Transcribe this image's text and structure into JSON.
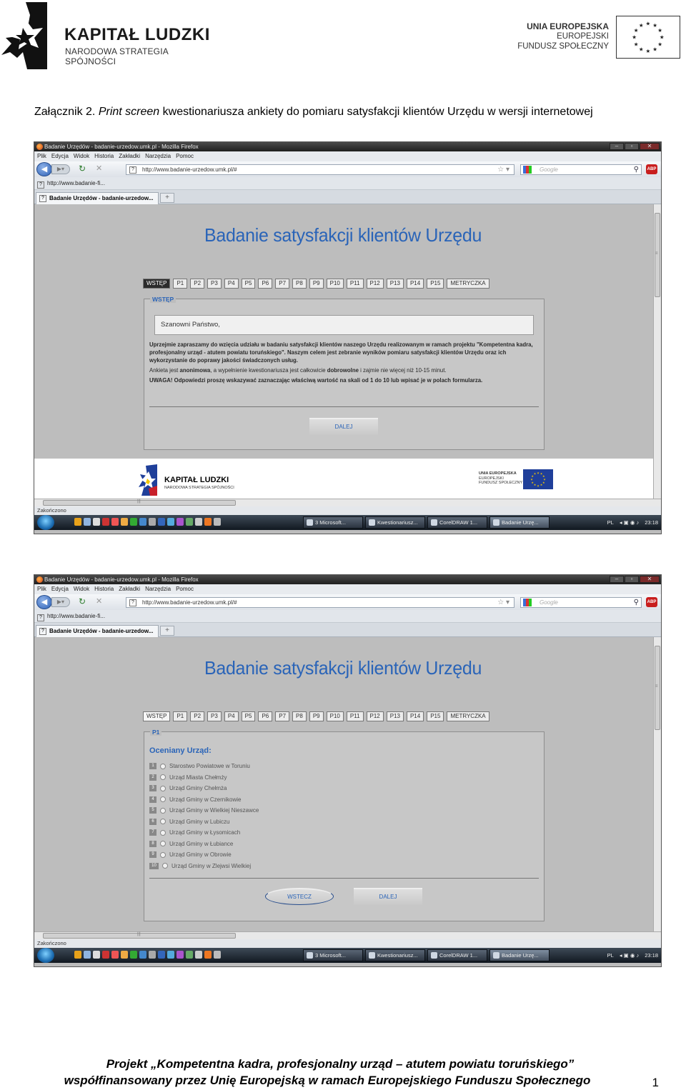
{
  "header": {
    "kl_title": "KAPITAŁ LUDZKI",
    "kl_subtitle": "NARODOWA STRATEGIA SPÓJNOŚCI",
    "ue_line1": "UNIA EUROPEJSKA",
    "ue_line2": "EUROPEJSKI",
    "ue_line3": "FUNDUSZ SPOŁECZNY"
  },
  "caption": {
    "prefix": "Załącznik 2. ",
    "italic": "Print screen",
    "rest": " kwestionariusza ankiety do pomiaru satysfakcji klientów Urzędu w wersji internetowej"
  },
  "browser": {
    "window_title": "Badanie Urzędów - badanie-urzedow.umk.pl - Mozilla Firefox",
    "menu": [
      "Plik",
      "Edycja",
      "Widok",
      "Historia",
      "Zakładki",
      "Narzędzia",
      "Pomoc"
    ],
    "url": "http://www.badanie-urzedow.umk.pl/#",
    "search_placeholder": "Google",
    "bookmark": "http://www.badanie-fi...",
    "tab": "Badanie Urzędów - badanie-urzedow...",
    "status": "Zakończono",
    "taskbar": {
      "tasks": [
        "3 Microsoft...",
        "Kwestionariusz...",
        "CorelDRAW 1...",
        "Badanie Urzę..."
      ],
      "lang": "PL",
      "time": "23:18"
    }
  },
  "survey": {
    "title": "Badanie satysfakcji klientów Urzędu",
    "steps": [
      "WSTĘP",
      "P1",
      "P2",
      "P3",
      "P4",
      "P5",
      "P6",
      "P7",
      "P8",
      "P9",
      "P10",
      "P11",
      "P12",
      "P13",
      "P14",
      "P15",
      "METRYCZKA"
    ],
    "footer_kl_title": "KAPITAŁ LUDZKI",
    "footer_kl_subtitle": "NARODOWA STRATEGIA SPÓJNOŚCI",
    "footer_ue_1": "UNIA EUROPEJSKA",
    "footer_ue_2": "EUROPEJSKI",
    "footer_ue_3": "FUNDUSZ SPOŁECZNY"
  },
  "screen1": {
    "legend": "WSTĘP",
    "greeting": "Szanowni Państwo,",
    "para1": "Uprzejmie zapraszamy do wzięcia udziału w badaniu satysfakcji klientów naszego Urzędu realizowanym w ramach projektu \"Kompetentna kadra, profesjonalny urząd - atutem powiatu toruńskiego\". Naszym celem jest zebranie wyników pomiaru satysfakcji klientów Urzędu oraz ich wykorzystanie do poprawy jakości świadczonych usług.",
    "para2_a": "Ankieta jest ",
    "para2_b": "anonimowa",
    "para2_c": ", a wypełnienie kwestionariusza jest całkowicie ",
    "para2_d": "dobrowolne",
    "para2_e": " i zajmie nie więcej niż 10-15 minut.",
    "para3": "UWAGA! Odpowiedzi proszę wskazywać zaznaczając właściwą wartość na skali od 1 do 10 lub wpisać je w polach formularza.",
    "next": "DALEJ"
  },
  "screen2": {
    "legend": "P1",
    "question": "Oceniany Urząd:",
    "options": [
      "Starostwo Powiatowe w Toruniu",
      "Urząd Miasta Chełmży",
      "Urząd Gminy Chełmża",
      "Urząd Gminy w Czernikowie",
      "Urząd Gminy w Wielkiej Nieszawce",
      "Urząd Gminy w Lubiczu",
      "Urząd Gminy w Łysomicach",
      "Urząd Gminy w Łubiance",
      "Urząd Gminy w Obrowie",
      "Urząd Gminy w Zlejwsi Wielkiej"
    ],
    "back": "WSTECZ",
    "next": "DALEJ"
  },
  "footer": {
    "line1": "Projekt „Kompetentna kadra, profesjonalny urząd – atutem powiatu toruńskiego”",
    "line2": "współfinansowany przez Unię Europejską w ramach Europejskiego Funduszu Społecznego",
    "page": "1"
  },
  "colors": {
    "accent": "#2a64b8",
    "panel": "#c7c7c7",
    "viewport": "#bdbdbd"
  }
}
